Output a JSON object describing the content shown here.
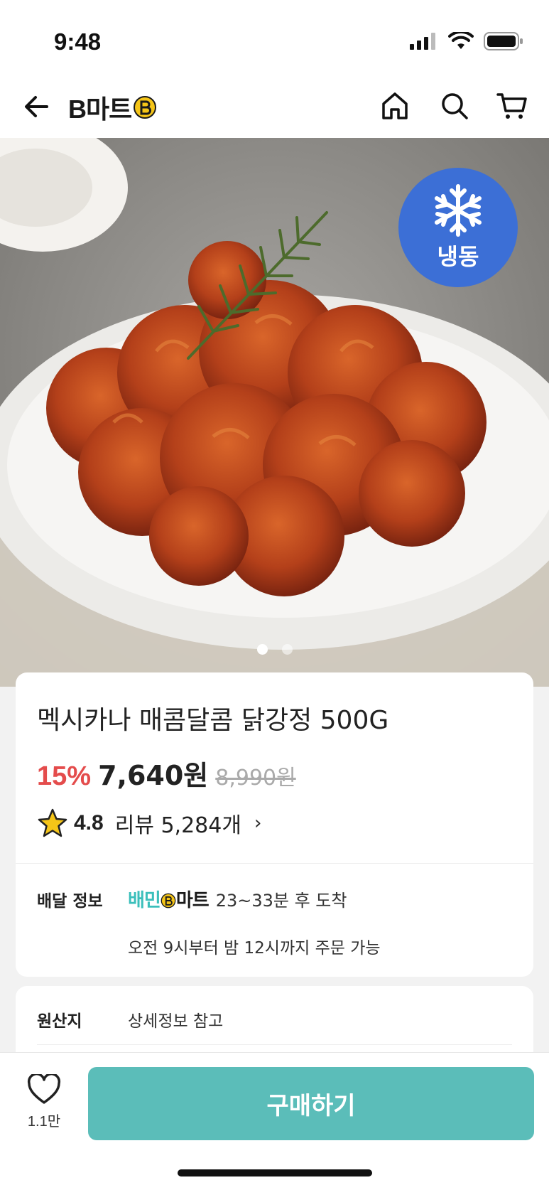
{
  "status": {
    "time": "9:48"
  },
  "nav": {
    "logo_text": "B마트",
    "icons": [
      "back-arrow-icon",
      "home-icon",
      "search-icon",
      "cart-icon"
    ]
  },
  "hero": {
    "badge_label": "냉동",
    "badge_icon": "snowflake-icon",
    "page_count": 2,
    "active_page": 1
  },
  "product": {
    "title": "멕시카나 매콤달콤 닭강정 500G",
    "discount": "15%",
    "price": "7,640원",
    "original_price": "8,990원",
    "rating": "4.8",
    "review": "리뷰 5,284개",
    "review_chevron": "›"
  },
  "delivery": {
    "label": "배달 정보",
    "logo_left": "배민",
    "logo_right": "마트",
    "eta": "23~33분 후 도착",
    "hours": "오전 9시부터 밤 12시까지 주문 가능"
  },
  "origin": {
    "label": "원산지",
    "value": "상세정보 참고"
  },
  "bottom": {
    "like_count": "1.1만",
    "buy_label": "구매하기"
  },
  "colors": {
    "accent": "#5bbdb9",
    "discount": "#e44c4c",
    "frozen_badge": "#3c6fd6"
  }
}
